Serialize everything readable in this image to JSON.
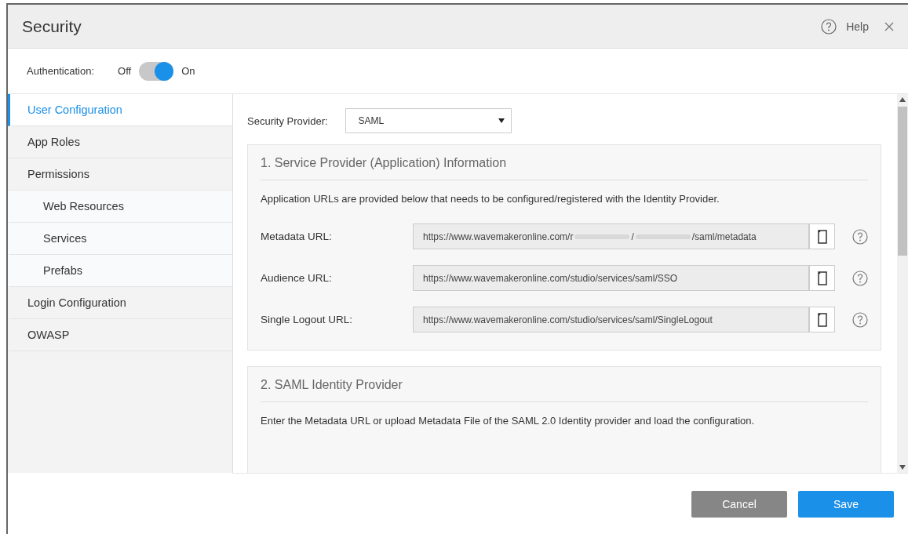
{
  "window": {
    "title": "Security",
    "help": "Help"
  },
  "authentication": {
    "label": "Authentication:",
    "off_label": "Off",
    "on_label": "On",
    "on": true
  },
  "sidebar": {
    "items": [
      {
        "label": "User Configuration",
        "selected": true
      },
      {
        "label": "App Roles",
        "selected": false
      },
      {
        "label": "Permissions",
        "selected": false,
        "children": [
          {
            "label": "Web Resources",
            "selected": false
          },
          {
            "label": "Services",
            "selected": false
          },
          {
            "label": "Prefabs",
            "selected": false
          }
        ]
      },
      {
        "label": "Login Configuration",
        "selected": false
      },
      {
        "label": "OWASP",
        "selected": false
      }
    ]
  },
  "provider": {
    "label": "Security Provider:",
    "value": "SAML"
  },
  "sections": [
    {
      "title": "1. Service Provider (Application) Information",
      "description": "Application URLs are provided below that needs to be configured/registered with the Identity Provider.",
      "fields": [
        {
          "label": "Metadata URL:",
          "value_parts": [
            "https://www.wavemakeronline.com/r",
            "/",
            "/saml/metadata"
          ]
        },
        {
          "label": "Audience URL:",
          "value_parts": [
            "https://www.wavemakeronline.com/studio/services/saml/SSO"
          ]
        },
        {
          "label": "Single Logout URL:",
          "value_parts": [
            "https://www.wavemakeronline.com/studio/services/saml/SingleLogout"
          ]
        }
      ]
    },
    {
      "title": "2. SAML Identity Provider",
      "description": "Enter the Metadata URL or upload Metadata File of the SAML 2.0 Identity provider and load the configuration."
    }
  ],
  "buttons": [
    {
      "label": "Cancel",
      "kind": "secondary"
    },
    {
      "label": "Save",
      "kind": "primary"
    }
  ]
}
